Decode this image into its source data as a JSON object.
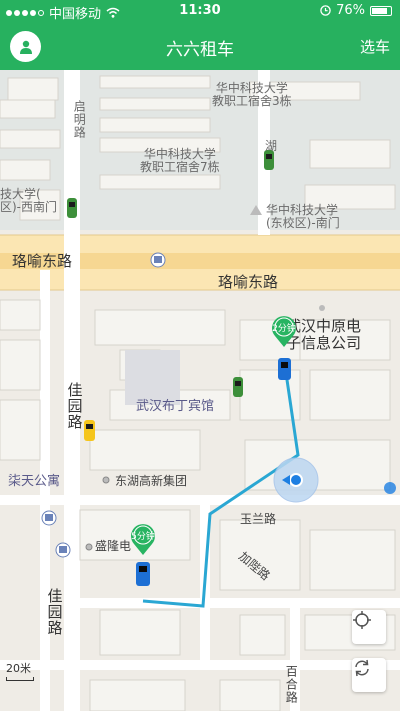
{
  "status_bar": {
    "carrier": "中国移动",
    "time": "11:30",
    "battery": "76%"
  },
  "nav": {
    "title": "六六租车",
    "right_action": "选车"
  },
  "colors": {
    "brand": "#27b15f",
    "route": "#2aa7d3",
    "pin": "#28b462"
  },
  "map": {
    "labels": {
      "campus_north": "华中科技大学\n教职工宿舍3栋",
      "campus_mid": "华中科技大学\n教职工宿舍7栋",
      "campus_west": "技大学(\n区)-西南门",
      "campus_east": "华中科技大学\n(东校区)-南门",
      "qiming_road": "启明路",
      "hu_road": "湖",
      "luoyu_west": "珞喻东路",
      "luoyu_east": "珞喻东路",
      "zhongyuan": "武汉中原电\n子信息公司",
      "budinghotel": "武汉布丁宾馆",
      "jiayuan_road_1": "佳园路",
      "jiayuan_road_2": "佳园路",
      "letian": "柒天公寓",
      "donghu_group": "东湖高新集团",
      "yulan_road": "玉兰路",
      "shenglong": "盛隆电",
      "jinwa_road": "加陛路",
      "baihe_road": "百合路"
    },
    "pins": [
      {
        "label": "2分钟"
      },
      {
        "label": "5分钟"
      }
    ],
    "scale": "20米"
  },
  "controls": {
    "locate": "locate-button",
    "refresh": "refresh-button"
  }
}
